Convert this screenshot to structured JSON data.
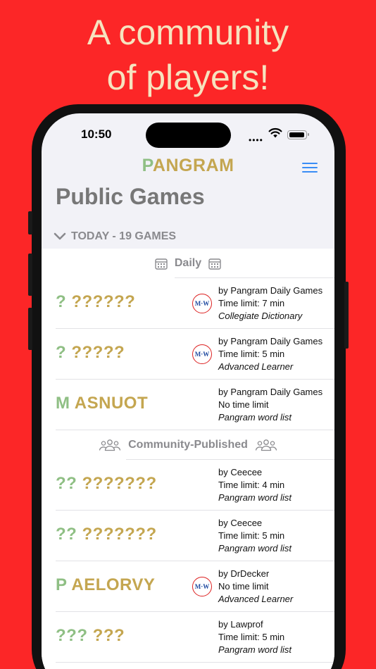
{
  "headline": {
    "line1": "A community",
    "line2": "of players!"
  },
  "status_bar": {
    "time": "10:50",
    "signal": "••••"
  },
  "nav": {
    "title_letter": "P",
    "title_rest": "ANGRAM"
  },
  "large_title": "Public Games",
  "section": {
    "label": "TODAY - 19 GAMES"
  },
  "daily": {
    "label": "Daily",
    "games": [
      {
        "center": "?",
        "outer": "??????",
        "by": "by Pangram Daily Games",
        "limit": "Time limit: 7 min",
        "dict": "Collegiate Dictionary",
        "badge": "M·W"
      },
      {
        "center": "?",
        "outer": "?????",
        "by": "by Pangram Daily Games",
        "limit": "Time limit: 5 min",
        "dict": "Advanced Learner",
        "badge": "M·W"
      },
      {
        "center": "M",
        "outer": "ASNUOT",
        "by": "by Pangram Daily Games",
        "limit": "No time limit",
        "dict": "Pangram word list",
        "badge": ""
      }
    ]
  },
  "community": {
    "label": "Community-Published",
    "games": [
      {
        "center": "??",
        "outer": "???????",
        "by": "by Ceecee",
        "limit": "Time limit: 4 min",
        "dict": "Pangram word list",
        "badge": ""
      },
      {
        "center": "??",
        "outer": "???????",
        "by": "by Ceecee",
        "limit": "Time limit: 5 min",
        "dict": "Pangram word list",
        "badge": ""
      },
      {
        "center": "P",
        "outer": "AELORVY",
        "by": "by DrDecker",
        "limit": "No time limit",
        "dict": "Advanced Learner",
        "badge": "M·W"
      },
      {
        "center": "???",
        "outer": "???",
        "by": "by Lawprof",
        "limit": "Time limit: 5 min",
        "dict": "Pangram word list",
        "badge": ""
      }
    ]
  },
  "colors": {
    "background": "#fc2627",
    "headline": "#f6e3bf",
    "center_letter": "#8fbf84",
    "outer_letters": "#c4a650",
    "accent": "#3a8df5"
  }
}
